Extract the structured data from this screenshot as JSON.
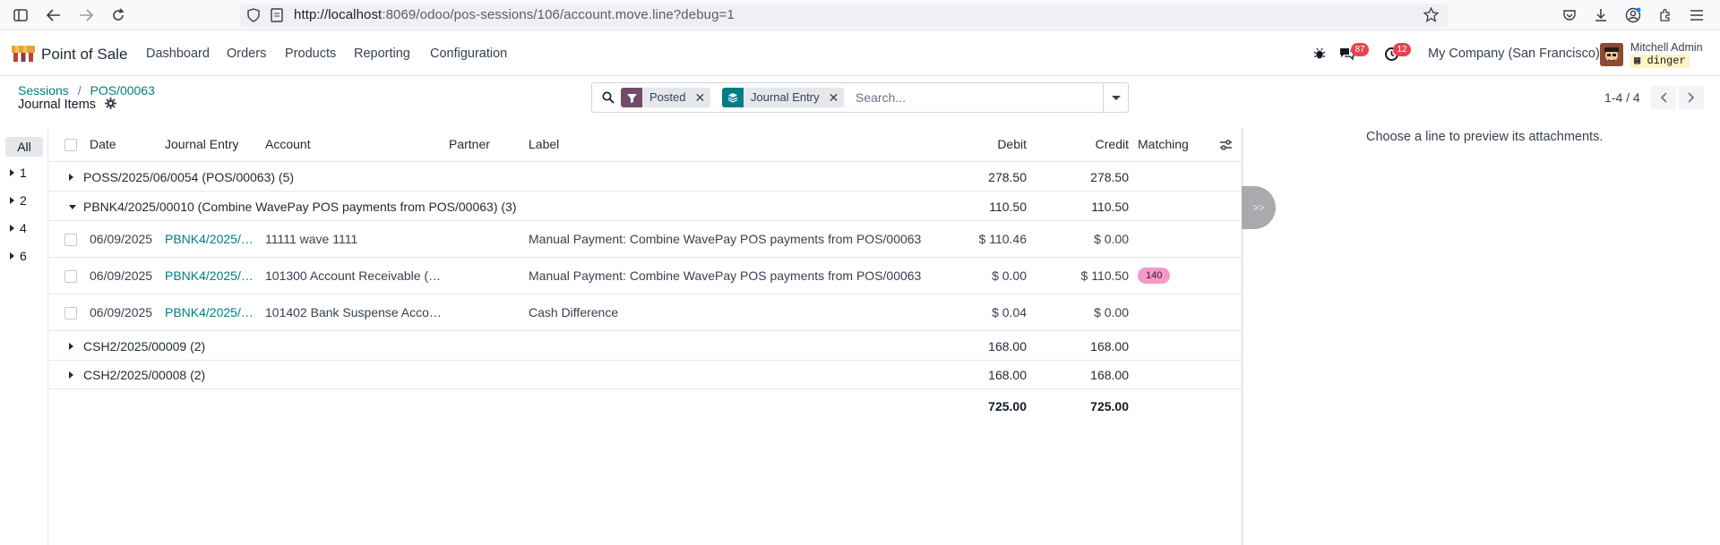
{
  "browser": {
    "url_host": "http://localhost",
    "url_rest": ":8069/odoo/pos-sessions/106/account.move.line?debug=1"
  },
  "navbar": {
    "app_name": "Point of Sale",
    "menu": [
      "Dashboard",
      "Orders",
      "Products",
      "Reporting",
      "Configuration"
    ],
    "messages_count": "87",
    "activities_count": "12",
    "company": "My Company (San Francisco)",
    "user_name": "Mitchell Admin",
    "db_name": "dinger"
  },
  "breadcrumb": {
    "items": [
      "Sessions",
      "POS/00063"
    ],
    "separator": "/",
    "title": "Journal Items"
  },
  "search": {
    "facets": [
      {
        "label": "Posted",
        "icon": "filter-icon",
        "color": "#714b67"
      },
      {
        "label": "Journal Entry",
        "icon": "group-layers-icon",
        "color": "#017e84"
      }
    ],
    "placeholder": "Search..."
  },
  "pager": {
    "text": "1-4 / 4"
  },
  "side_panel": {
    "items": [
      "All",
      "1",
      "2",
      "4",
      "6"
    ]
  },
  "table": {
    "headers": {
      "date": "Date",
      "journal_entry": "Journal Entry",
      "account": "Account",
      "partner": "Partner",
      "label": "Label",
      "debit": "Debit",
      "credit": "Credit",
      "matching": "Matching"
    },
    "groups": [
      {
        "name": "POSS/2025/06/0054 (POS/00063) (5)",
        "debit": "278.50",
        "credit": "278.50",
        "expanded": false
      },
      {
        "name": "PBNK4/2025/00010 (Combine WavePay POS payments from POS/00063) (3)",
        "debit": "110.50",
        "credit": "110.50",
        "expanded": true
      },
      {
        "name": "CSH2/2025/00009 (2)",
        "debit": "168.00",
        "credit": "168.00",
        "expanded": false
      },
      {
        "name": "CSH2/2025/00008 (2)",
        "debit": "168.00",
        "credit": "168.00",
        "expanded": false
      }
    ],
    "lines": [
      {
        "date": "06/09/2025",
        "entry": "PBNK4/2025/…",
        "account": "11111 wave 1111",
        "label": "Manual Payment: Combine WavePay POS payments from POS/00063",
        "debit": "$ 110.46",
        "credit": "$ 0.00",
        "matching": ""
      },
      {
        "date": "06/09/2025",
        "entry": "PBNK4/2025/…",
        "account": "101300 Account Receivable (…",
        "label": "Manual Payment: Combine WavePay POS payments from POS/00063",
        "debit": "$ 0.00",
        "credit": "$ 110.50",
        "matching": "140"
      },
      {
        "date": "06/09/2025",
        "entry": "PBNK4/2025/…",
        "account": "101402 Bank Suspense Acco…",
        "label": "Cash Difference",
        "debit": "$ 0.04",
        "credit": "$ 0.00",
        "matching": ""
      }
    ],
    "totals": {
      "debit": "725.00",
      "credit": "725.00"
    }
  },
  "preview": {
    "empty_text": "Choose a line to preview its attachments.",
    "expand_label": ">>"
  }
}
